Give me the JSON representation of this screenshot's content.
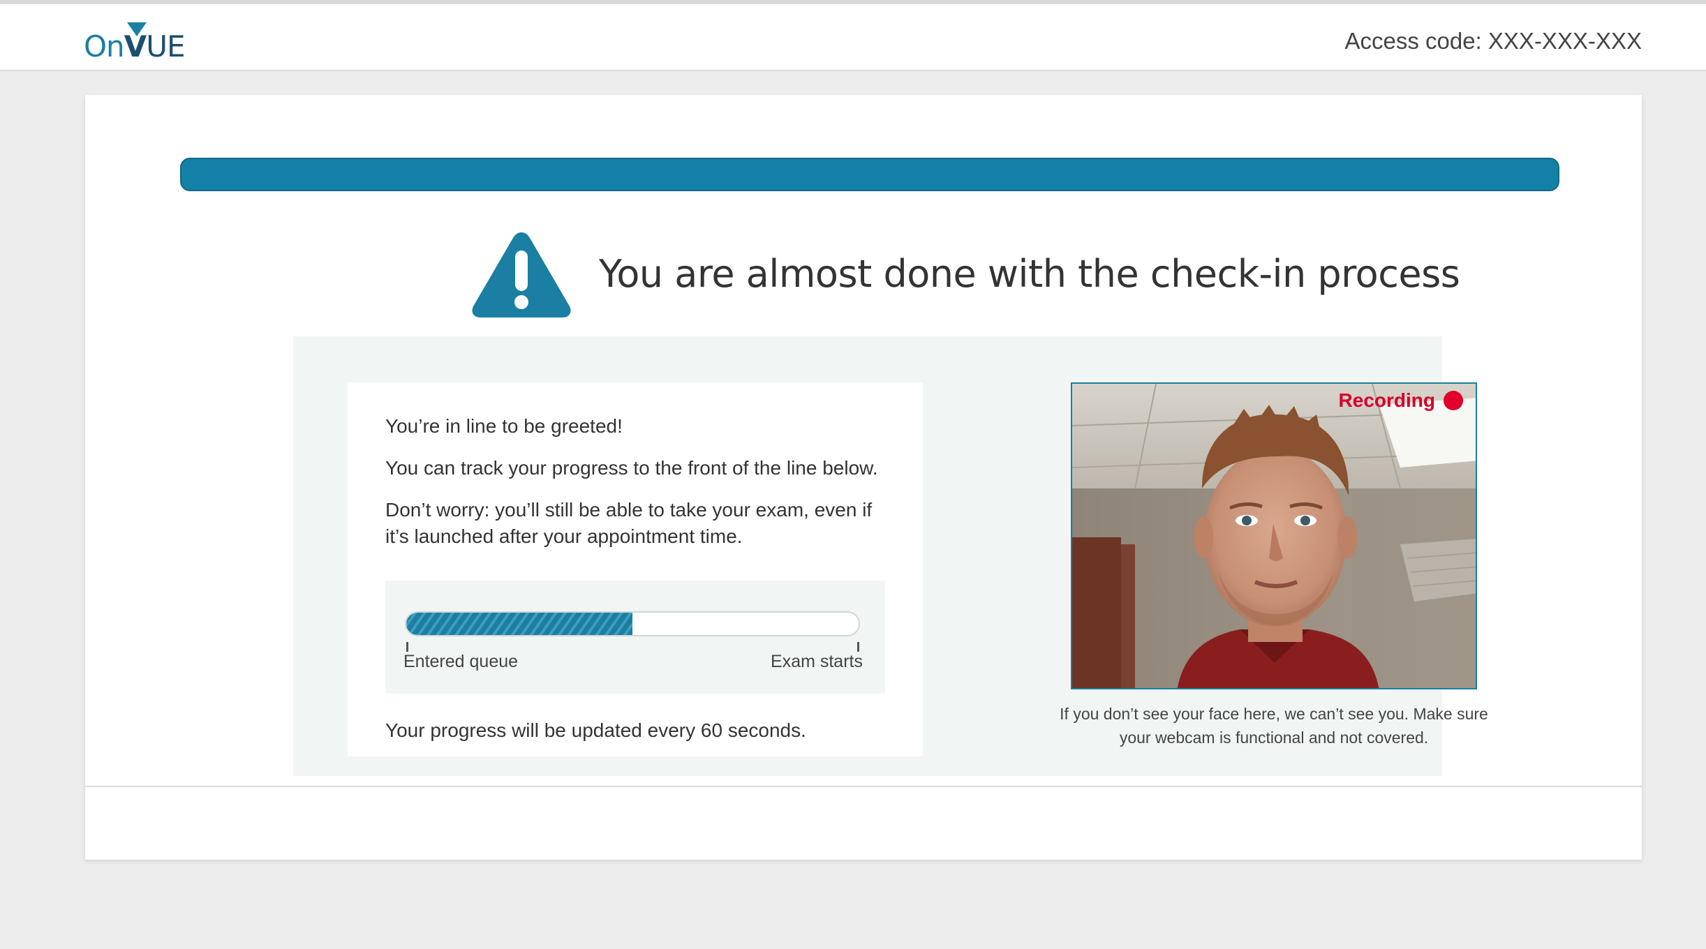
{
  "header": {
    "logo_on": "On",
    "logo_v": "V",
    "logo_ue": "UE",
    "access_code": "Access code: XXX-XXX-XXX"
  },
  "main": {
    "headline": "You are almost done with the check-in process",
    "warning_icon": "warning-triangle-icon"
  },
  "queue": {
    "line1": "You’re in line to be greeted!",
    "line2": "You can track your progress to the front of the line below.",
    "line3": "Don’t worry: you’ll still be able to take your exam, even if it’s launched after your appointment time.",
    "progress_fraction": 0.5,
    "label_start": "Entered queue",
    "label_end": "Exam starts",
    "update_note": "Your progress will be updated every 60 seconds."
  },
  "webcam": {
    "recording_label": "Recording",
    "caption": "If you don’t see your face here, we can’t see you. Make sure your webcam is functional and not covered."
  },
  "colors": {
    "brand_teal": "#1480a8",
    "recording_red": "#e0002b",
    "panel_bg": "#f1f6f4"
  }
}
